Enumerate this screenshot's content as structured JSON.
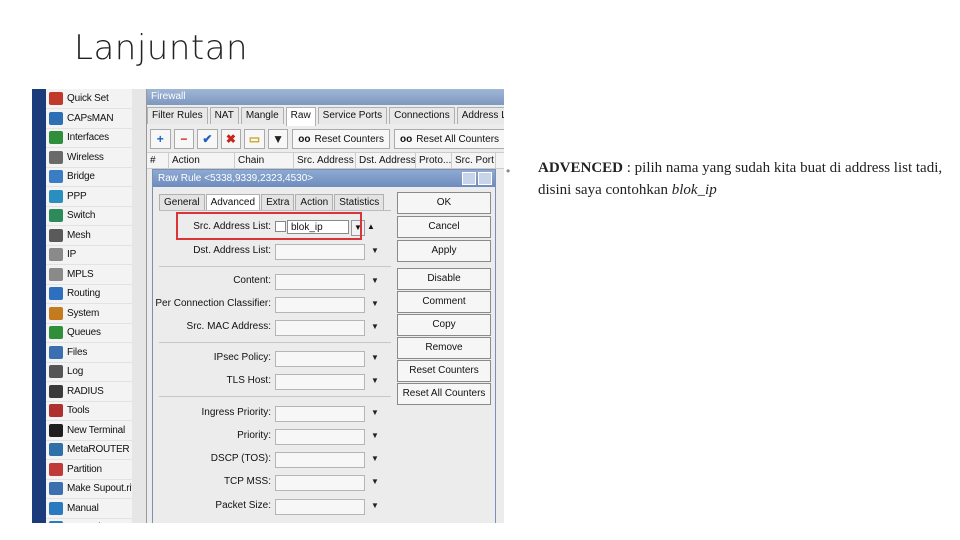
{
  "slide": {
    "title": "Lanjuntan"
  },
  "sidebar": {
    "items": [
      {
        "label": "Quick Set",
        "icon": "quick-set-icon",
        "color": "#c0392b",
        "arrow": false
      },
      {
        "label": "CAPsMAN",
        "icon": "capsman-icon",
        "color": "#2c6fb5",
        "arrow": false
      },
      {
        "label": "Interfaces",
        "icon": "interfaces-icon",
        "color": "#2f8f3a",
        "arrow": false
      },
      {
        "label": "Wireless",
        "icon": "wireless-icon",
        "color": "#6a6a6a",
        "arrow": false
      },
      {
        "label": "Bridge",
        "icon": "bridge-icon",
        "color": "#3b7dc4",
        "arrow": false
      },
      {
        "label": "PPP",
        "icon": "ppp-icon",
        "color": "#2a8fc0",
        "arrow": false
      },
      {
        "label": "Switch",
        "icon": "switch-icon",
        "color": "#2d8a59",
        "arrow": false
      },
      {
        "label": "Mesh",
        "icon": "mesh-icon",
        "color": "#5a5a5a",
        "arrow": false
      },
      {
        "label": "IP",
        "icon": "ip-icon",
        "color": "#8a8a8a",
        "arrow": true
      },
      {
        "label": "MPLS",
        "icon": "mpls-icon",
        "color": "#8a8a8a",
        "arrow": true
      },
      {
        "label": "Routing",
        "icon": "routing-icon",
        "color": "#2f6fbf",
        "arrow": true
      },
      {
        "label": "System",
        "icon": "system-icon",
        "color": "#c47a1e",
        "arrow": true
      },
      {
        "label": "Queues",
        "icon": "queues-icon",
        "color": "#2f8f3a",
        "arrow": false
      },
      {
        "label": "Files",
        "icon": "files-icon",
        "color": "#3b6fb0",
        "arrow": false
      },
      {
        "label": "Log",
        "icon": "log-icon",
        "color": "#555555",
        "arrow": false
      },
      {
        "label": "RADIUS",
        "icon": "radius-icon",
        "color": "#3a3a3a",
        "arrow": false
      },
      {
        "label": "Tools",
        "icon": "tools-icon",
        "color": "#b03030",
        "arrow": true
      },
      {
        "label": "New Terminal",
        "icon": "terminal-icon",
        "color": "#1f1f1f",
        "arrow": false
      },
      {
        "label": "MetaROUTER",
        "icon": "metarouter-icon",
        "color": "#3070a8",
        "arrow": false
      },
      {
        "label": "Partition",
        "icon": "partition-icon",
        "color": "#c03a3a",
        "arrow": false
      },
      {
        "label": "Make Supout.rif",
        "icon": "supout-icon",
        "color": "#3b6fb0",
        "arrow": false
      },
      {
        "label": "Manual",
        "icon": "manual-icon",
        "color": "#2a7ac0",
        "arrow": false
      },
      {
        "label": "New WinBox",
        "icon": "winbox-icon",
        "color": "#2a7ac0",
        "arrow": false
      }
    ]
  },
  "firewall": {
    "title": "Firewall",
    "tabs": [
      "Filter Rules",
      "NAT",
      "Mangle",
      "Raw",
      "Service Ports",
      "Connections",
      "Address Lists"
    ],
    "toolbar": {
      "reset_counters": "Reset Counters",
      "reset_all_counters": "Reset All Counters"
    },
    "columns": [
      "#",
      "Action",
      "Chain",
      "Src. Address",
      "Dst. Address",
      "Proto...",
      "Src. Port"
    ]
  },
  "dialog": {
    "title": "Raw Rule <5338,9339,2323,4530>",
    "tabs": [
      "General",
      "Advanced",
      "Extra",
      "Action",
      "Statistics"
    ],
    "fields": {
      "src_address_list": {
        "label": "Src. Address List:",
        "value": "blok_ip"
      },
      "dst_address_list": {
        "label": "Dst. Address List:"
      },
      "content": {
        "label": "Content:"
      },
      "per_connection_classifier": {
        "label": "Per Connection Classifier:"
      },
      "src_mac_address": {
        "label": "Src. MAC Address:"
      },
      "ipsec_policy": {
        "label": "IPsec Policy:"
      },
      "tls_host": {
        "label": "TLS Host:"
      },
      "ingress_priority": {
        "label": "Ingress Priority:"
      },
      "priority": {
        "label": "Priority:"
      },
      "dscp": {
        "label": "DSCP (TOS):"
      },
      "tcp_mss": {
        "label": "TCP MSS:"
      },
      "packet_size": {
        "label": "Packet Size:"
      }
    },
    "buttons": [
      "OK",
      "Cancel",
      "Apply",
      "Disable",
      "Comment",
      "Copy",
      "Remove",
      "Reset Counters",
      "Reset All Counters"
    ]
  },
  "note": {
    "bullet": "•",
    "term": "ADVENCED",
    "text": " : pilih nama yang sudah kita buat di address list tadi, disini saya contohkan ",
    "example": "blok_ip"
  },
  "colors": {
    "highlight": "#d9343a",
    "title_bar": "#7e98bf",
    "sidebar_strip": "#1c3b7a"
  }
}
